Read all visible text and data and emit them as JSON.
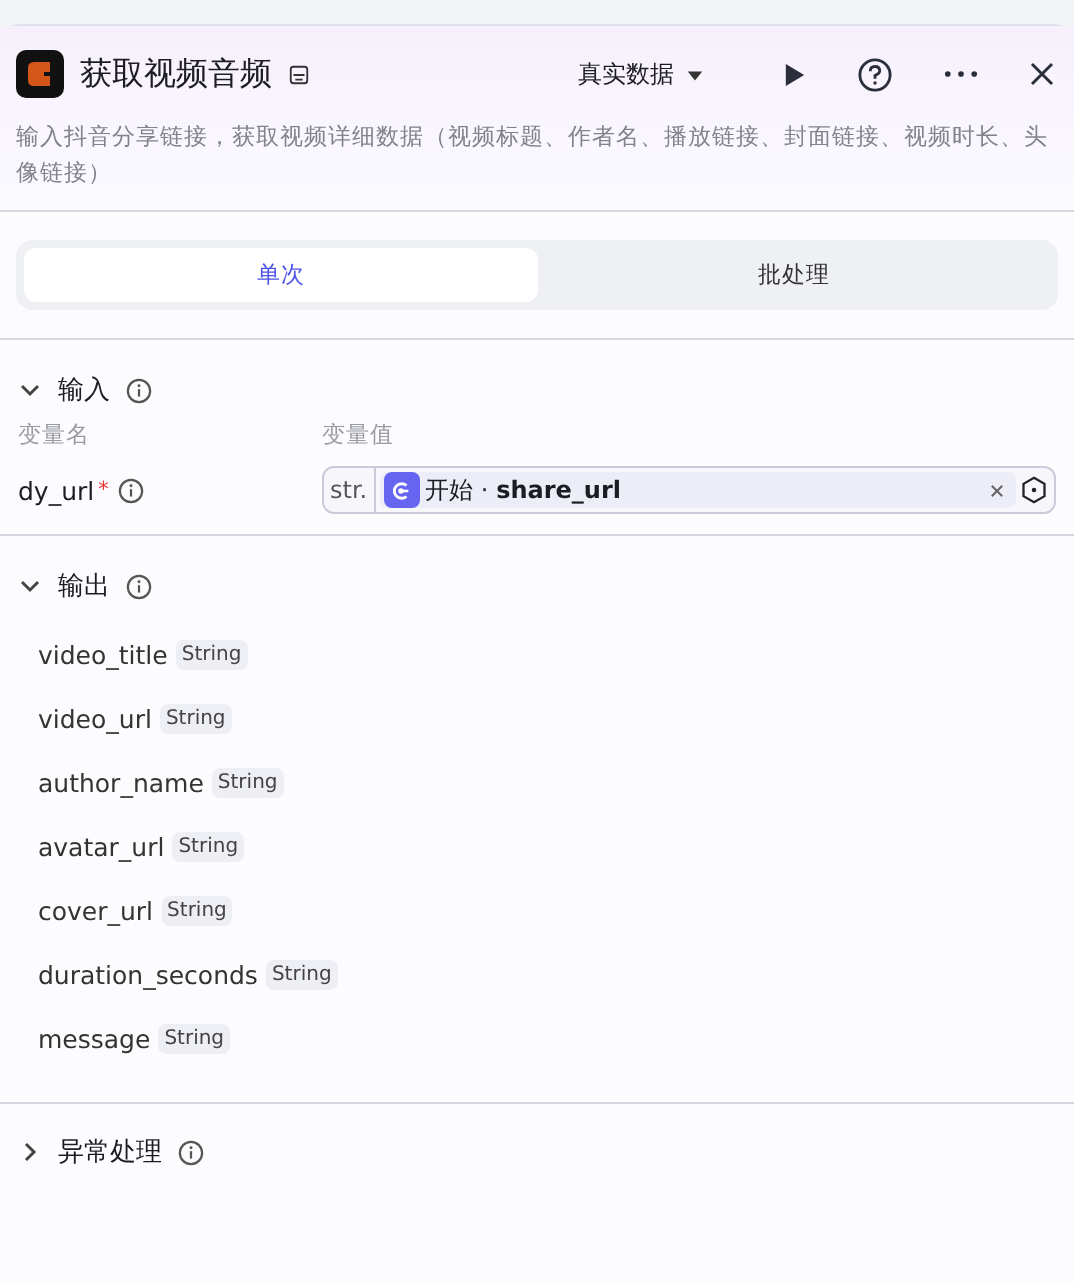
{
  "header": {
    "title": "获取视频音频",
    "data_mode": "真实数据",
    "description": "输入抖音分享链接，获取视频详细数据（视频标题、作者名、播放链接、封面链接、视频时长、头像链接）"
  },
  "tabs": [
    {
      "label": "单次",
      "selected": true
    },
    {
      "label": "批处理",
      "selected": false
    }
  ],
  "input": {
    "title": "输入",
    "expanded": true,
    "columns": [
      "变量名",
      "变量值"
    ],
    "rows": [
      {
        "name": "dy_url",
        "required_mark": "*",
        "type": "str.",
        "reference": "开始 · **share_url**"
      }
    ]
  },
  "output": {
    "title": "输出",
    "expanded": true,
    "fields": [
      {
        "name": "video_title",
        "type": "String"
      },
      {
        "name": "video_url",
        "type": "String"
      },
      {
        "name": "author_name",
        "type": "String"
      },
      {
        "name": "avatar_url",
        "type": "String"
      },
      {
        "name": "cover_url",
        "type": "String"
      },
      {
        "name": "duration_seconds",
        "type": "String"
      },
      {
        "name": "message",
        "type": "String"
      }
    ]
  },
  "exception": {
    "title": "异常处理",
    "expanded": false
  }
}
